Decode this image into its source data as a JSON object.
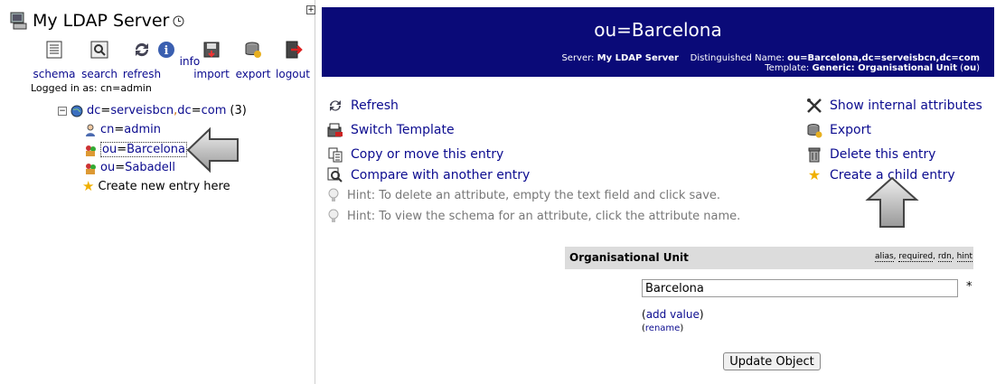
{
  "left": {
    "title": "My LDAP Server",
    "toolbar": [
      {
        "label": "schema",
        "icon": "schema-icon"
      },
      {
        "label": "search",
        "icon": "search-icon"
      },
      {
        "label": "refresh",
        "icon": "refresh-icon"
      },
      {
        "label": "info",
        "icon": "info-icon"
      },
      {
        "label": "import",
        "icon": "import-icon"
      },
      {
        "label": "export",
        "icon": "export-icon"
      },
      {
        "label": "logout",
        "icon": "logout-icon"
      }
    ],
    "logged_in_label": "Logged in as:",
    "logged_in_attr": "cn",
    "logged_in_value": "admin",
    "tree": {
      "root_a": "dc",
      "root_b": "serveisbcn",
      "root_c": "dc",
      "root_d": "com",
      "root_count": "(3)",
      "items": [
        {
          "attr": "cn",
          "value": "admin"
        },
        {
          "attr": "ou",
          "value": "Barcelona"
        },
        {
          "attr": "ou",
          "value": "Sabadell"
        }
      ],
      "create_label": "Create new entry here"
    }
  },
  "header": {
    "dn_title": "ou=Barcelona",
    "server_label": "Server:",
    "server_value": "My LDAP Server",
    "dn_label": "Distinguished Name:",
    "dn_value": "ou=Barcelona,dc=serveisbcn,dc=com",
    "template_label": "Template:",
    "template_value": "Generic: Organisational Unit",
    "template_oc": "ou",
    "bg_color": "#0a0a78"
  },
  "actions": {
    "refresh": "Refresh",
    "switch_template": "Switch Template",
    "copy_move": "Copy or move this entry",
    "compare": "Compare with another entry",
    "show_internal": "Show internal attributes",
    "export": "Export",
    "delete": "Delete this entry",
    "create_child": "Create a child entry"
  },
  "hints": [
    "Hint: To delete an attribute, empty the text field and click save.",
    "Hint: To view the schema for an attribute, click the attribute name."
  ],
  "attribute": {
    "name": "Organisational Unit",
    "notes": [
      "alias",
      "required",
      "rdn",
      "hint"
    ],
    "value": "Barcelona",
    "required_mark": "*",
    "add_value": "add value",
    "rename": "rename"
  },
  "update_button": "Update Object"
}
